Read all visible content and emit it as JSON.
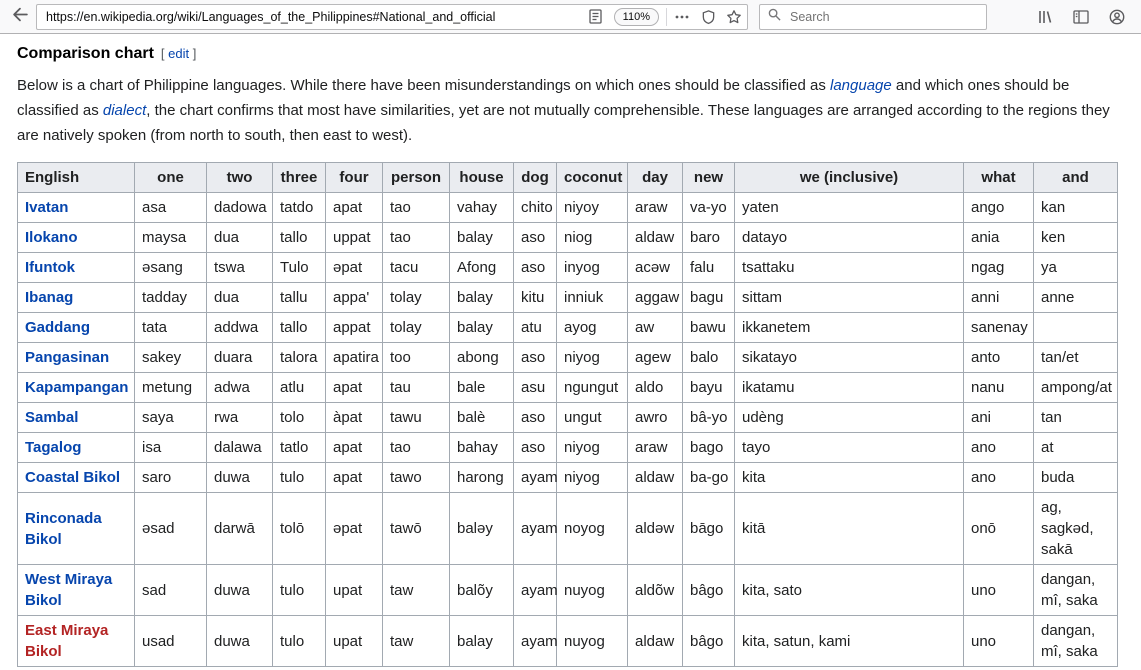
{
  "colors": {
    "link_blue": "#0645ad",
    "link_red": "#b32424",
    "table_header_bg": "#eaecf0",
    "table_border": "#a2a9b1",
    "toolbar_bg": "#f9f9fa"
  },
  "browser": {
    "url": "https://en.wikipedia.org/wiki/Languages_of_the_Philippines#National_and_official",
    "zoom": "110%",
    "search_placeholder": "Search",
    "icons": [
      "back-arrow",
      "reader-mode",
      "page-actions-dots",
      "shield",
      "bookmark-star",
      "search-magnifier",
      "library",
      "sidebar",
      "account"
    ]
  },
  "article": {
    "heading": "Comparison chart",
    "edit_bracket_open": "[",
    "edit_label": "edit",
    "edit_bracket_close": "]",
    "paragraph": {
      "part1": "Below is a chart of Philippine languages. While there have been misunderstandings on which ones should be classified as ",
      "link1": "language",
      "part2": " and which ones should be classified as ",
      "link2": "dialect",
      "part3": ", the chart confirms that most have similarities, yet are not mutually comprehensible. These languages are arranged according to the regions they are natively spoken (from north to south, then east to west)."
    }
  },
  "table": {
    "headers": [
      "English",
      "one",
      "two",
      "three",
      "four",
      "person",
      "house",
      "dog",
      "coconut",
      "day",
      "new",
      "we (inclusive)",
      "what",
      "and"
    ],
    "rows": [
      {
        "language": "Ivatan",
        "link_color": "blue",
        "cells": [
          "asa",
          "dadowa",
          "tatdo",
          "apat",
          "tao",
          "vahay",
          "chito",
          "niyoy",
          "araw",
          "va-yo",
          "yaten",
          "ango",
          "kan"
        ]
      },
      {
        "language": "Ilokano",
        "link_color": "blue",
        "cells": [
          "maysa",
          "dua",
          "tallo",
          "uppat",
          "tao",
          "balay",
          "aso",
          "niog",
          "aldaw",
          "baro",
          "datayo",
          "ania",
          "ken"
        ]
      },
      {
        "language": "Ifuntok",
        "link_color": "blue",
        "cells": [
          "əsang",
          "tswa",
          "Tulo",
          "əpat",
          "tacu",
          "Afong",
          "aso",
          "inyog",
          "acəw",
          "falu",
          "tsattaku",
          "ngag",
          "ya"
        ]
      },
      {
        "language": "Ibanag",
        "link_color": "blue",
        "cells": [
          "tadday",
          "dua",
          "tallu",
          "appa'",
          "tolay",
          "balay",
          "kitu",
          "inniuk",
          "aggaw",
          "bagu",
          "sittam",
          "anni",
          "anne"
        ]
      },
      {
        "language": "Gaddang",
        "link_color": "blue",
        "cells": [
          "tata",
          "addwa",
          "tallo",
          "appat",
          "tolay",
          "balay",
          "atu",
          "ayog",
          "aw",
          "bawu",
          "ikkanetem",
          "sanenay",
          ""
        ]
      },
      {
        "language": "Pangasinan",
        "link_color": "blue",
        "cells": [
          "sakey",
          "duara",
          "talora",
          "apatira",
          "too",
          "abong",
          "aso",
          "niyog",
          "agew",
          "balo",
          "sikatayo",
          "anto",
          "tan/et"
        ]
      },
      {
        "language": "Kapampangan",
        "link_color": "blue",
        "cells": [
          "metung",
          "adwa",
          "atlu",
          "apat",
          "tau",
          "bale",
          "asu",
          "ngungut",
          "aldo",
          "bayu",
          "ikatamu",
          "nanu",
          "ampong/at"
        ]
      },
      {
        "language": "Sambal",
        "link_color": "blue",
        "cells": [
          "saya",
          "rwa",
          "tolo",
          "àpat",
          "tawu",
          "balè",
          "aso",
          "ungut",
          "awro",
          "bâ-yo",
          "udèng",
          "ani",
          "tan"
        ]
      },
      {
        "language": "Tagalog",
        "link_color": "blue",
        "cells": [
          "isa",
          "dalawa",
          "tatlo",
          "apat",
          "tao",
          "bahay",
          "aso",
          "niyog",
          "araw",
          "bago",
          "tayo",
          "ano",
          "at"
        ]
      },
      {
        "language": "Coastal Bikol",
        "link_color": "blue",
        "cells": [
          "saro",
          "duwa",
          "tulo",
          "apat",
          "tawo",
          "harong",
          "ayam",
          "niyog",
          "aldaw",
          "ba-go",
          "kita",
          "ano",
          "buda"
        ]
      },
      {
        "language": "Rinconada Bikol",
        "link_color": "blue",
        "cells": [
          "əsad",
          "darwā",
          "tolō",
          "əpat",
          "tawō",
          "baləy",
          "ayam",
          "noyog",
          "aldəw",
          "bāgo",
          "kitā",
          "onō",
          "ag, sagkəd, sakā"
        ]
      },
      {
        "language": "West Miraya Bikol",
        "link_color": "blue",
        "cells": [
          "sad",
          "duwa",
          "tulo",
          "upat",
          "taw",
          "balõy",
          "ayam",
          "nuyog",
          "aldõw",
          "bâgo",
          "kita, sato",
          "uno",
          "dangan, mî, saka"
        ]
      },
      {
        "language": "East Miraya Bikol",
        "link_color": "red",
        "cells": [
          "usad",
          "duwa",
          "tulo",
          "upat",
          "taw",
          "balay",
          "ayam",
          "nuyog",
          "aldaw",
          "bâgo",
          "kita, satun, kami",
          "uno",
          "dangan, mî, saka"
        ]
      }
    ]
  }
}
